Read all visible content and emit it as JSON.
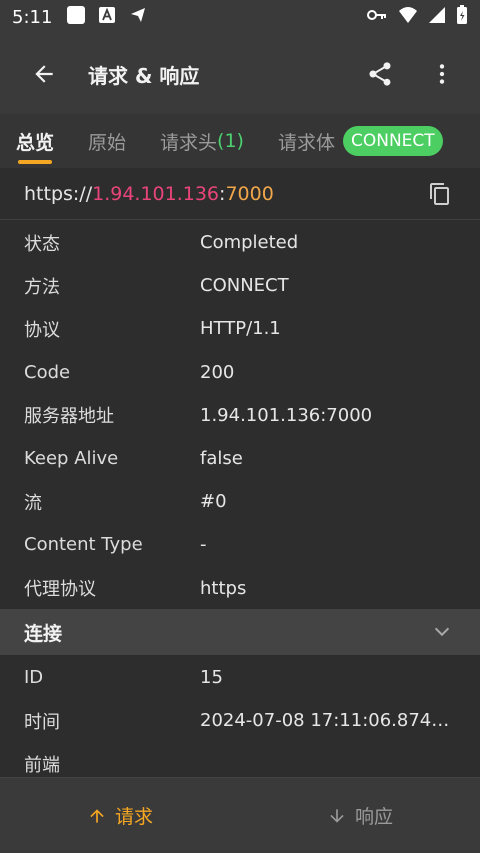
{
  "status_bar": {
    "time": "5:11"
  },
  "app_bar": {
    "title": "请求 & 响应"
  },
  "tabs": [
    {
      "label": "总览",
      "active": true
    },
    {
      "label": "原始"
    },
    {
      "label": "请求头",
      "count": "(1)"
    },
    {
      "label": "请求体"
    }
  ],
  "method_badge": "CONNECT",
  "url": {
    "scheme": "https://",
    "host": "1.94.101.136",
    "sep": ":",
    "port": "7000"
  },
  "overview": [
    {
      "key": "状态",
      "value": "Completed"
    },
    {
      "key": "方法",
      "value": "CONNECT"
    },
    {
      "key": "协议",
      "value": "HTTP/1.1"
    },
    {
      "key": "Code",
      "value": "200"
    },
    {
      "key": "服务器地址",
      "value": "1.94.101.136:7000"
    },
    {
      "key": "Keep Alive",
      "value": "false"
    },
    {
      "key": "流",
      "value": "#0"
    },
    {
      "key": "Content Type",
      "value": "-"
    },
    {
      "key": "代理协议",
      "value": "https"
    }
  ],
  "connection_section": {
    "title": "连接",
    "rows": [
      {
        "key": "ID",
        "value": "15"
      },
      {
        "key": "时间",
        "value": "2024-07-08 17:11:06.874…"
      },
      {
        "key": "前端",
        "value": ""
      }
    ]
  },
  "bottom_bar": {
    "request_label": "请求",
    "response_label": "响应"
  },
  "colors": {
    "accent": "#f5a623",
    "badge": "#4cce62",
    "host": "#e9457a",
    "port": "#f0a64a"
  }
}
